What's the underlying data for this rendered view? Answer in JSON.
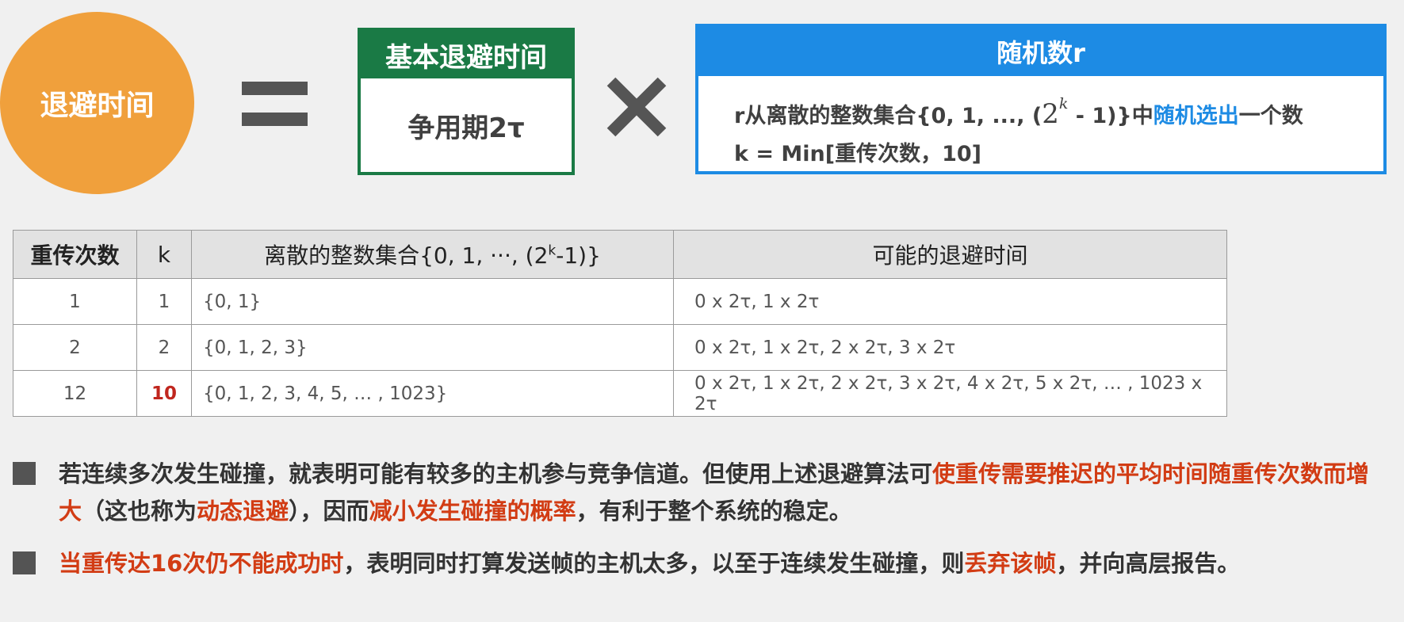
{
  "formula": {
    "circle_label": "退避时间",
    "base_box": {
      "title": "基本退避时间",
      "content": "争用期2τ"
    },
    "random_box": {
      "title": "随机数r",
      "line1_pre": "r从离散的整数集合{0, 1, ..., (",
      "line1_base": "2",
      "line1_exp": "k",
      "line1_mid": " - 1)}中",
      "line1_highlight": "随机选出",
      "line1_post": "一个数",
      "line2": "k = Min[重传次数，10]"
    }
  },
  "table": {
    "headers": {
      "retries": "重传次数",
      "k": "k",
      "set_pre": "离散的整数集合{0, 1, ···, (2",
      "set_exp": "k",
      "set_post": "-1)}",
      "times": "可能的退避时间"
    },
    "rows": [
      {
        "retries": "1",
        "k": "1",
        "set": "{0, 1}",
        "times": "0 x 2τ,  1 x 2τ"
      },
      {
        "retries": "2",
        "k": "2",
        "set": "{0, 1, 2, 3}",
        "times": "0 x 2τ,  1 x 2τ, 2 x 2τ, 3 x 2τ"
      },
      {
        "retries": "12",
        "k": "10",
        "set": "{0, 1, 2, 3, 4, 5,  … , 1023}",
        "times": "0 x 2τ,  1 x 2τ, 2 x 2τ, 3 x 2τ, 4 x 2τ, 5 x 2τ, … , 1023 x 2τ"
      }
    ]
  },
  "bullets": {
    "b1": {
      "part1": "若连续多次发生碰撞，就表明可能有较多的主机参与竞争信道。但使用上述退避算法可",
      "part2_red": "使重传需要推迟的平均时间随重传次数而增大",
      "part3": "（这也称为",
      "part4_red": "动态退避",
      "part5": "），因而",
      "part6_red": "减小发生碰撞的概率",
      "part7": "，有利于整个系统的稳定。"
    },
    "b2": {
      "part1_red": "当重传达16次仍不能成功时",
      "part2": "，表明同时打算发送帧的主机太多，以至于连续发生碰撞，则",
      "part3_red": "丢弃该帧",
      "part4": "，并向高层报告。"
    }
  },
  "colors": {
    "circle": "#f0a03c",
    "base_box": "#1a7a45",
    "random_box": "#1d8be4",
    "highlight_red": "#d23c14",
    "k_red": "#c0261e"
  }
}
